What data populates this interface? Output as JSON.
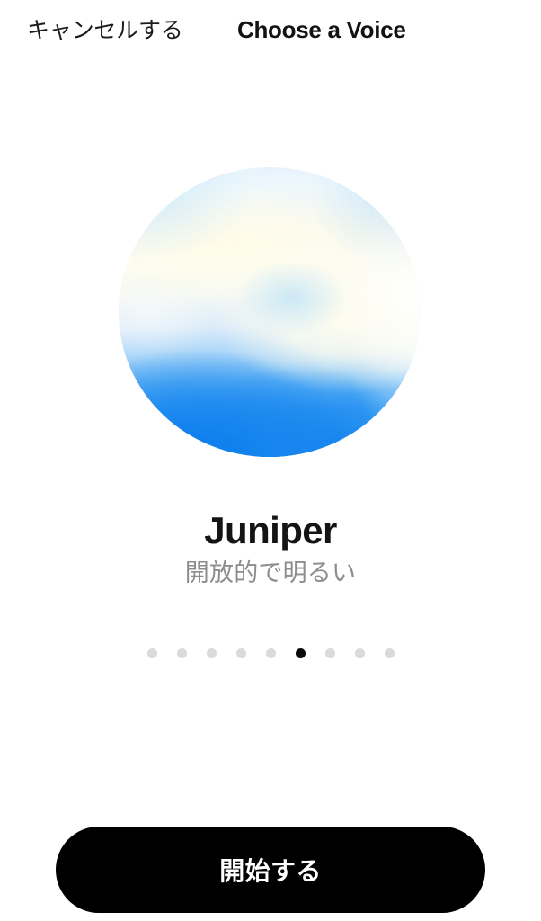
{
  "header": {
    "cancel_label": "キャンセルする",
    "title": "Choose a Voice"
  },
  "voice": {
    "name": "Juniper",
    "description": "開放的で明るい",
    "orb_colors": {
      "top_cream": "#fdfcef",
      "top_pale_blue": "#e2f1fb",
      "mid_light_blue": "#a9d5f8",
      "bottom_blue": "#1484ee",
      "deep_blue": "#0a7cec"
    }
  },
  "pagination": {
    "total": 9,
    "active_index": 5,
    "dot_color": "#dadada",
    "active_dot_color": "#0a0a0a"
  },
  "footer": {
    "start_label": "開始する",
    "button_color": "#000000",
    "button_text_color": "#ffffff"
  }
}
